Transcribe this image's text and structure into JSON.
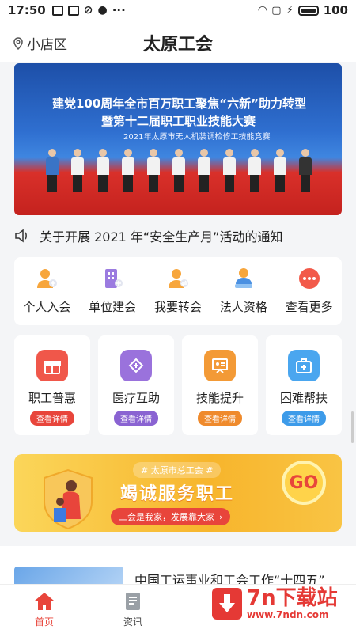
{
  "status_bar": {
    "time": "17:50",
    "battery": "100"
  },
  "header": {
    "location": "小店区",
    "title": "太原工会"
  },
  "banner": {
    "line1": "建党100周年全市百万职工聚焦“六新”助力转型",
    "line2": "暨第十二届职工职业技能大赛",
    "line3": "2021年太原市无人机装调检修工技能竞赛"
  },
  "notice": {
    "text": "关于开展 2021 年“安全生产月”活动的通知"
  },
  "quick_actions": [
    {
      "label": "个人入会",
      "icon": "person-add-icon"
    },
    {
      "label": "单位建会",
      "icon": "building-add-icon"
    },
    {
      "label": "我要转会",
      "icon": "person-transfer-icon"
    },
    {
      "label": "法人资格",
      "icon": "legal-person-icon"
    },
    {
      "label": "查看更多",
      "icon": "more-icon"
    }
  ],
  "service_cards": [
    {
      "label": "职工普惠",
      "button": "查看详情",
      "color": "#e8453b",
      "icon": "gift-icon"
    },
    {
      "label": "医疗互助",
      "button": "查看详情",
      "color": "#8a63d2",
      "icon": "medical-heart-icon"
    },
    {
      "label": "技能提升",
      "button": "查看详情",
      "color": "#ef8a2c",
      "icon": "skill-board-icon"
    },
    {
      "label": "困难帮扶",
      "button": "查看详情",
      "color": "#3d9be9",
      "icon": "first-aid-icon"
    }
  ],
  "promo": {
    "tag": "# 太原市总工会 #",
    "main": "竭诚服务职工",
    "sub": "工会是我家，发展靠大家",
    "go": "GO"
  },
  "news": {
    "title": "中国工运事业和工会工作“十四五”"
  },
  "tabbar": [
    {
      "label": "首页",
      "icon": "home-icon",
      "active": true
    },
    {
      "label": "资讯",
      "icon": "news-icon",
      "active": false
    }
  ],
  "watermark": {
    "name": "7n下载站",
    "url": "www.7ndn.com"
  },
  "colors": {
    "accent": "#e8453b",
    "header_bg": "#ffffff",
    "page_bg": "#f4f5f7"
  }
}
